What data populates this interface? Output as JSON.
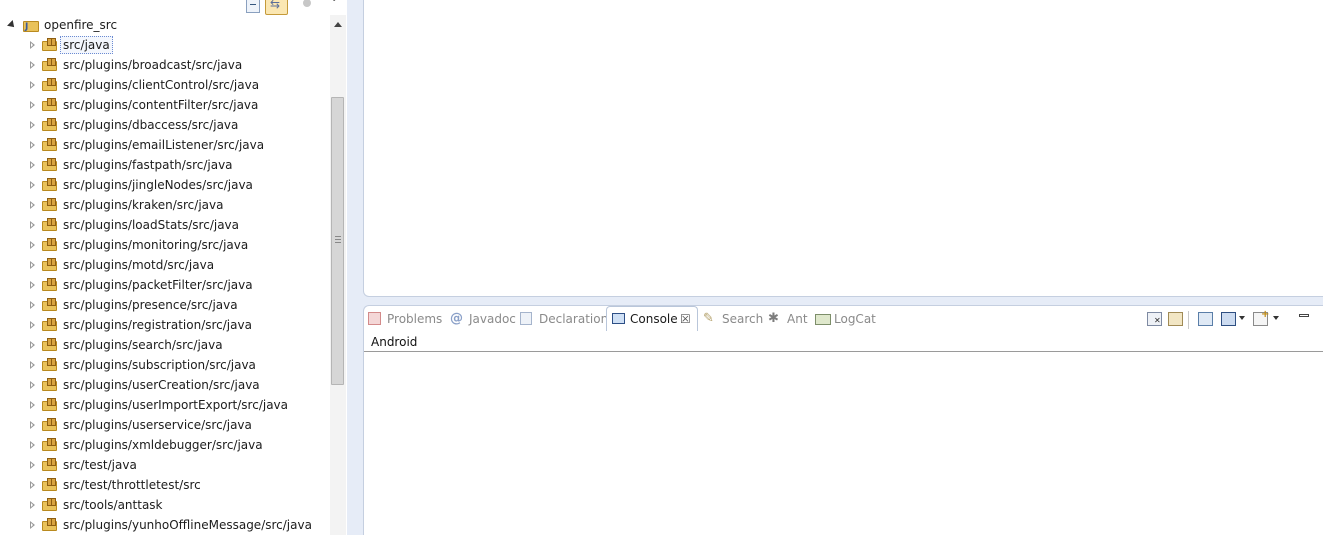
{
  "explorer": {
    "project": "openfire_src",
    "packages": [
      "src/java",
      "src/plugins/broadcast/src/java",
      "src/plugins/clientControl/src/java",
      "src/plugins/contentFilter/src/java",
      "src/plugins/dbaccess/src/java",
      "src/plugins/emailListener/src/java",
      "src/plugins/fastpath/src/java",
      "src/plugins/jingleNodes/src/java",
      "src/plugins/kraken/src/java",
      "src/plugins/loadStats/src/java",
      "src/plugins/monitoring/src/java",
      "src/plugins/motd/src/java",
      "src/plugins/packetFilter/src/java",
      "src/plugins/presence/src/java",
      "src/plugins/registration/src/java",
      "src/plugins/search/src/java",
      "src/plugins/subscription/src/java",
      "src/plugins/userCreation/src/java",
      "src/plugins/userImportExport/src/java",
      "src/plugins/userservice/src/java",
      "src/plugins/xmldebugger/src/java",
      "src/test/java",
      "src/test/throttletest/src",
      "src/tools/anttask",
      "src/plugins/yunhoOfflineMessage/src/java"
    ],
    "selected_index": 0
  },
  "console_panel": {
    "tabs": [
      {
        "label": "Problems",
        "icon": "problems-icon",
        "active": false
      },
      {
        "label": "Javadoc",
        "icon": "javadoc-icon",
        "active": false
      },
      {
        "label": "Declaration",
        "icon": "declaration-icon",
        "active": false
      },
      {
        "label": "Console",
        "icon": "console-icon",
        "active": true
      },
      {
        "label": "Search",
        "icon": "search-icon",
        "active": false
      },
      {
        "label": "Ant",
        "icon": "ant-icon",
        "active": false
      },
      {
        "label": "LogCat",
        "icon": "logcat-icon",
        "active": false
      }
    ],
    "console_name": "Android",
    "close_glyph": "☒"
  },
  "colors": {
    "panel_background": "#e6ecf7",
    "active_tab_border": "#b9c6da",
    "inactive_tab_text": "#8a8a8a"
  }
}
